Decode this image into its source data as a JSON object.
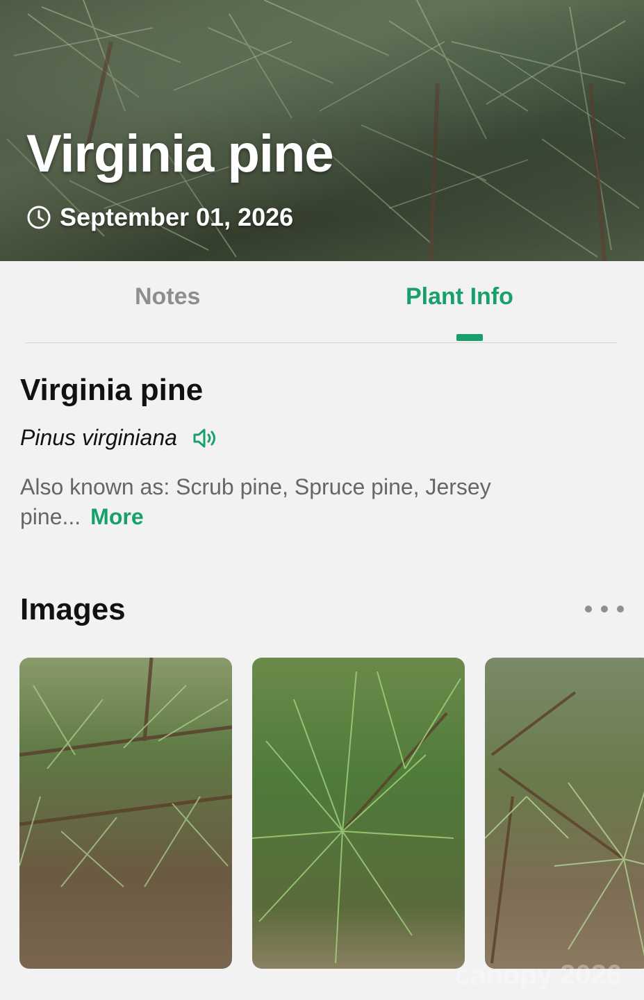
{
  "hero": {
    "title": "Virginia pine",
    "date": "September 01, 2026",
    "clock_icon": "clock-icon"
  },
  "tabs": [
    {
      "label": "Notes",
      "active": false
    },
    {
      "label": "Plant Info",
      "active": true
    }
  ],
  "plant": {
    "common_name": "Virginia pine",
    "scientific_name": "Pinus virginiana",
    "aka": "Also known as: Scrub pine, Spruce pine, Jersey pine...",
    "more_label": "More",
    "speaker_icon": "speaker-icon"
  },
  "images": {
    "title": "Images",
    "more_icon": "more-dots-icon",
    "count_visible": 3
  },
  "watermark": "canopy 2026",
  "colors": {
    "accent": "#17a06b",
    "inactive_tab": "#8e8e8e",
    "background": "#f2f2f2",
    "text": "#111111",
    "secondary_text": "#666666"
  }
}
